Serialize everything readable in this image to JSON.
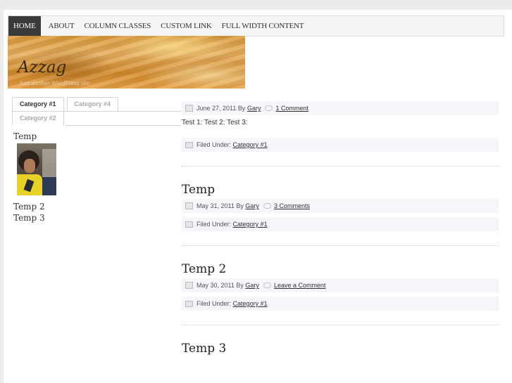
{
  "nav": {
    "items": [
      "HOME",
      "ABOUT",
      "COLUMN CLASSES",
      "CUSTOM LINK",
      "FULL WIDTH CONTENT"
    ]
  },
  "header": {
    "title": "Azzag",
    "description": "Just another WordPress site"
  },
  "sidebar": {
    "tabs": [
      "Category #1",
      "Category #4",
      "Category #2"
    ],
    "posts": [
      "Temp",
      "Temp 2",
      "Temp 3"
    ]
  },
  "posts": [
    {
      "title": "",
      "date": "June 27, 2011",
      "by": "By",
      "author": "Gary",
      "comments": "1 Comment",
      "excerpt": "Test 1: Test 2: Test 3:",
      "filed_label": "Filed Under:",
      "category": "Category #1"
    },
    {
      "title": "Temp",
      "date": "May 31, 2011",
      "by": "By",
      "author": "Gary",
      "comments": "3 Comments",
      "filed_label": "Filed Under:",
      "category": "Category #1"
    },
    {
      "title": "Temp 2",
      "date": "May 30, 2011",
      "by": "By",
      "author": "Gary",
      "comments": "Leave a Comment",
      "filed_label": "Filed Under:",
      "category": "Category #1"
    },
    {
      "title": "Temp 3"
    }
  ]
}
